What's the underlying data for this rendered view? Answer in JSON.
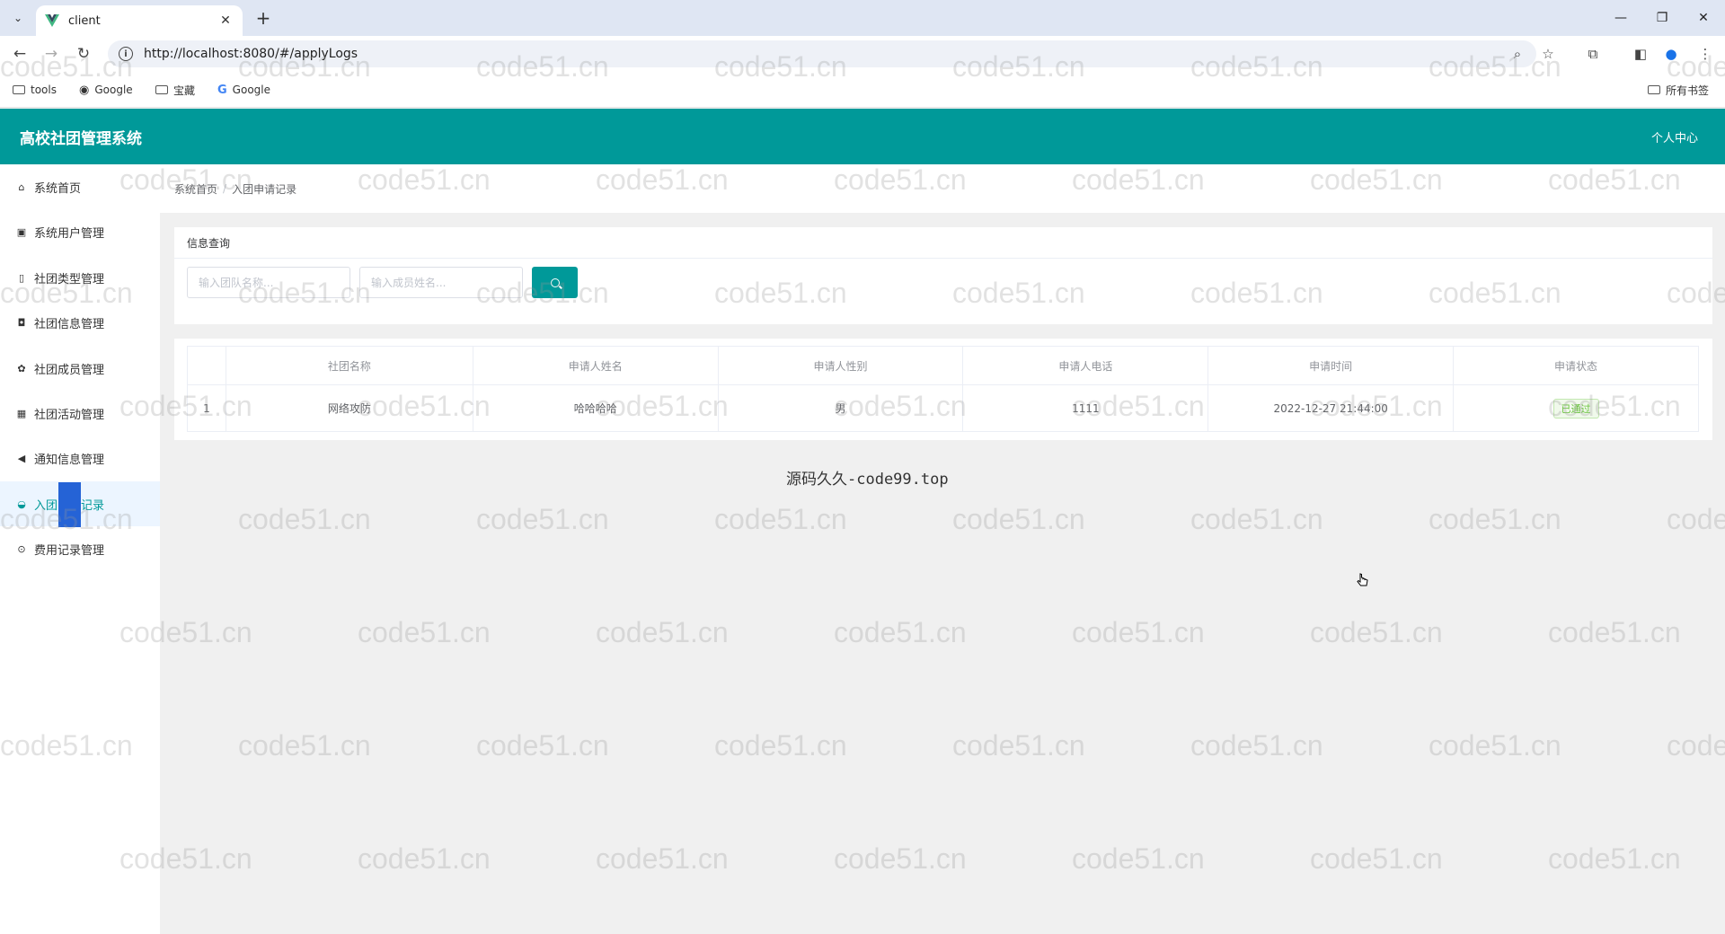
{
  "browser": {
    "tab_title": "client",
    "url": "http://localhost:8080/#/applyLogs",
    "bookmarks": [
      {
        "label": "tools",
        "icon": "folder-icon"
      },
      {
        "label": "Google",
        "icon": "globe-icon"
      },
      {
        "label": "宝藏",
        "icon": "folder-icon"
      },
      {
        "label": "Google",
        "icon": "google-icon"
      }
    ],
    "all_bookmarks": "所有书签"
  },
  "header": {
    "title": "高校社团管理系统",
    "user_center": "个人中心",
    "color": "#009999"
  },
  "sidebar": {
    "items": [
      {
        "label": "系统首页",
        "icon": "home-icon"
      },
      {
        "label": "系统用户管理",
        "icon": "user-icon"
      },
      {
        "label": "社团类型管理",
        "icon": "document-icon"
      },
      {
        "label": "社团信息管理",
        "icon": "train-icon"
      },
      {
        "label": "社团成员管理",
        "icon": "users-icon"
      },
      {
        "label": "社团活动管理",
        "icon": "calculator-icon"
      },
      {
        "label": "通知信息管理",
        "icon": "megaphone-icon"
      },
      {
        "label": "入团申请记录",
        "icon": "inbox-icon"
      },
      {
        "label": "费用记录管理",
        "icon": "circle-icon"
      }
    ],
    "active_index": 7
  },
  "breadcrumb": {
    "home": "系统首页",
    "separator": "/",
    "current": "入团申请记录"
  },
  "query": {
    "title": "信息查询",
    "team_name_placeholder": "输入团队名称...",
    "member_name_placeholder": "输入成员姓名..."
  },
  "table": {
    "columns": [
      "",
      "社团名称",
      "申请人姓名",
      "申请人性别",
      "申请人电话",
      "申请时间",
      "申请状态"
    ],
    "rows": [
      {
        "index": "1",
        "club": "网络攻防",
        "name": "哈哈哈哈",
        "gender": "男",
        "phone": "1111",
        "time": "2022-12-27 21:44:00",
        "status": "已通过"
      }
    ]
  },
  "footer_text": "源码久久-code99.top",
  "watermark": "code51.cn"
}
